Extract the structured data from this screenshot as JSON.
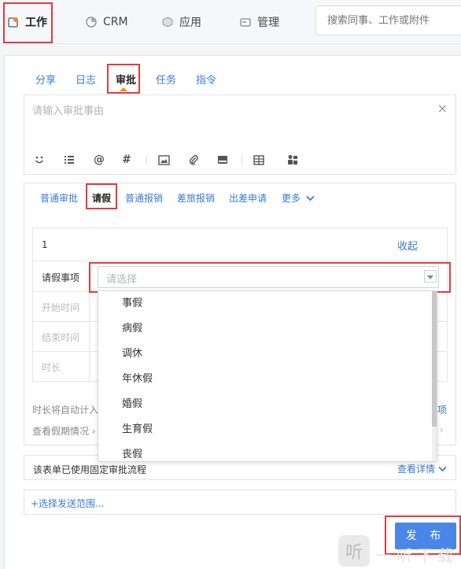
{
  "topnav": {
    "items": [
      {
        "label": "工作",
        "icon": "work-icon"
      },
      {
        "label": "CRM",
        "icon": "crm-icon"
      },
      {
        "label": "应用",
        "icon": "app-icon"
      },
      {
        "label": "管理",
        "icon": "manage-icon"
      }
    ],
    "search_placeholder": "搜索同事、工作或附件"
  },
  "publish_tabs": [
    "分享",
    "日志",
    "审批",
    "任务",
    "指令"
  ],
  "editor": {
    "placeholder": "请输入审批事由",
    "close": "×"
  },
  "toolbar": [
    "emoji-icon",
    "list-icon",
    "at-icon",
    "hash-icon",
    "image-icon",
    "attachment-icon",
    "keyboard-icon",
    "table-icon",
    "people-icon"
  ],
  "approval_types": [
    "普通审批",
    "请假",
    "普通报销",
    "差旅报销",
    "出差申请",
    "更多"
  ],
  "form": {
    "row_index": "1",
    "collapse": "收起",
    "fields": {
      "leave_type": "请假事项",
      "start_time": "开始时间",
      "end_time": "结束时间",
      "duration": "时长"
    },
    "select_placeholder": "请选择",
    "options": [
      "事假",
      "病假",
      "调休",
      "年休假",
      "婚假",
      "生育假",
      "丧假"
    ],
    "auto_note": "时长将自动计入",
    "auto_note_right": "项",
    "view_holiday": "查看假期情况 ›"
  },
  "flow": {
    "text": "该表单已使用固定审批流程",
    "detail": "查看详情"
  },
  "range": "+选择发送范围...",
  "publish_button": "发 布",
  "watermark": {
    "logo": "听",
    "text": "一听下载"
  },
  "colors": {
    "accent": "#4a86e8",
    "link": "#3a7bd5",
    "highlight": "#e43b3b"
  }
}
